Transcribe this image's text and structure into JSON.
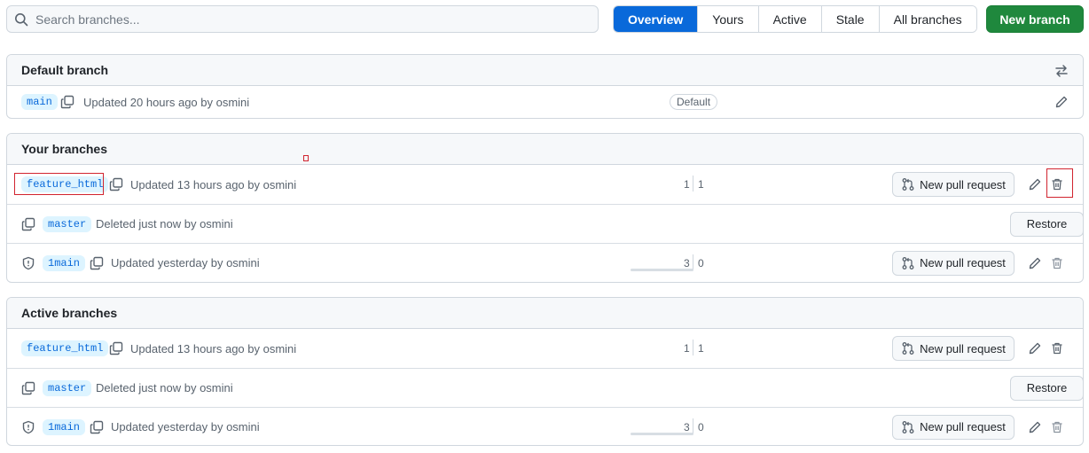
{
  "search": {
    "placeholder": "Search branches..."
  },
  "tabs": [
    {
      "label": "Overview",
      "active": true
    },
    {
      "label": "Yours",
      "active": false
    },
    {
      "label": "Active",
      "active": false
    },
    {
      "label": "Stale",
      "active": false
    },
    {
      "label": "All branches",
      "active": false
    }
  ],
  "new_branch_label": "New branch",
  "default_section": {
    "title": "Default branch",
    "row": {
      "branch": "main",
      "meta": "Updated 20 hours ago by osmini",
      "badge": "Default"
    }
  },
  "your_section": {
    "title": "Your branches",
    "rows": [
      {
        "branch": "feature_html",
        "meta": "Updated 13 hours ago by osmini",
        "behind": "1",
        "ahead": "1",
        "action": "New pull request"
      },
      {
        "branch": "master",
        "meta": "Deleted just now by osmini",
        "action": "Restore"
      },
      {
        "branch": "1main",
        "meta": "Updated yesterday by osmini",
        "behind": "3",
        "ahead": "0",
        "action": "New pull request"
      }
    ]
  },
  "active_section": {
    "title": "Active branches",
    "rows": [
      {
        "branch": "feature_html",
        "meta": "Updated 13 hours ago by osmini",
        "behind": "1",
        "ahead": "1",
        "action": "New pull request"
      },
      {
        "branch": "master",
        "meta": "Deleted just now by osmini",
        "action": "Restore"
      },
      {
        "branch": "1main",
        "meta": "Updated yesterday by osmini",
        "behind": "3",
        "ahead": "0",
        "action": "New pull request"
      }
    ]
  },
  "icons": {
    "search": "search-icon",
    "copy": "copy-icon",
    "pencil": "pencil-icon",
    "trash": "trash-icon",
    "pull_request": "git-pull-request-icon",
    "shield": "shield-icon",
    "switch": "arrow-switch-icon"
  },
  "colors": {
    "accent": "#0969da",
    "primary_button": "#1f883d",
    "highlight_box": "#d1242f"
  }
}
